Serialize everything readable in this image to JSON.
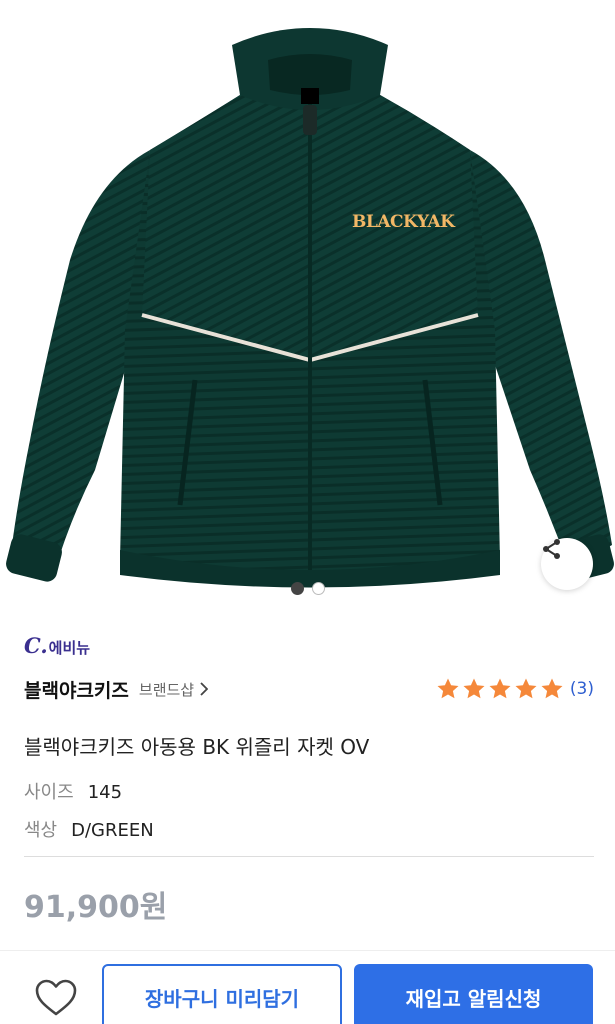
{
  "product_image": {
    "logo_text": "BLACKYAK",
    "slide_count": 2,
    "active_slide": 1
  },
  "seller": {
    "prefix": "C.",
    "name": "에비뉴"
  },
  "brand": {
    "name": "블랙야크키즈",
    "shop_link": "브랜드샵"
  },
  "rating": {
    "stars": 5,
    "count": "(3)"
  },
  "product": {
    "title": "블랙야크키즈 아동용 BK 위즐리 자켓 OV",
    "size_label": "사이즈",
    "size_value": "145",
    "color_label": "색상",
    "color_value": "D/GREEN",
    "price": "91,900원"
  },
  "actions": {
    "cart_label": "장바구니 미리담기",
    "alarm_label": "재입고 알림신청"
  },
  "colors": {
    "accent": "#2e6fe6",
    "star": "#f5883a",
    "jacket": "#0f3d36",
    "seller": "#3a2f8f"
  }
}
